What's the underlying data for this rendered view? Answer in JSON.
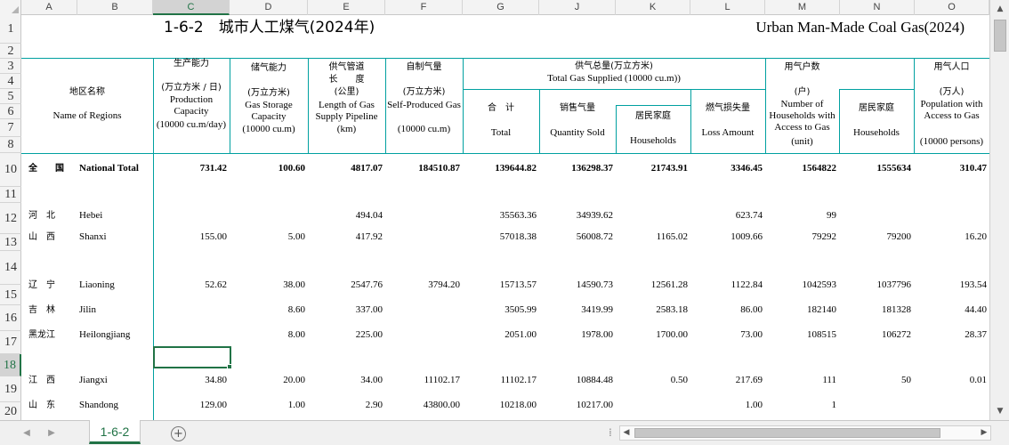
{
  "columns": {
    "A": "A",
    "B": "B",
    "C": "C",
    "D": "D",
    "E": "E",
    "F": "F",
    "G": "G",
    "J": "J",
    "K": "K",
    "L": "L",
    "M": "M",
    "N": "N",
    "O": "O"
  },
  "rows": [
    "1",
    "2",
    "3",
    "4",
    "5",
    "6",
    "7",
    "8",
    "10",
    "11",
    "12",
    "13",
    "14",
    "15",
    "16",
    "17",
    "18",
    "19",
    "20"
  ],
  "title": {
    "cn": "1-6-2　城市人工煤气(2024年)",
    "en": "Urban Man-Made Coal Gas(2024)"
  },
  "headers": {
    "region_cn": "地区名称",
    "region_en": "Name of Regions",
    "prod_cn": "生产能力",
    "prod_unit": "(万立方米 / 日)",
    "prod_en": "Production Capacity",
    "prod_en2": "(10000 cu.m/day)",
    "storage_cn": "储气能力",
    "storage_unit": "(万立方米)",
    "storage_en": "Gas Storage Capacity",
    "storage_en2": "(10000 cu.m)",
    "pipe_cn": "供气管道",
    "pipe_cn2": "长　　度",
    "pipe_unit": "(公里)",
    "pipe_en": "Length of Gas Supply Pipeline",
    "pipe_en2": "(km)",
    "self_cn": "自制气量",
    "self_unit": "(万立方米)",
    "self_en": "Self-Produced Gas",
    "self_en2": "(10000 cu.m)",
    "supply_cn": "供气总量(万立方米)",
    "supply_en": "Total Gas Supplied (10000 cu.m))",
    "total_cn": "合　计",
    "total_en": "Total",
    "sold_cn": "销售气量",
    "sold_en": "Quantity Sold",
    "hh_cn": "居民家庭",
    "hh_en": "Households",
    "loss_cn": "燃气损失量",
    "loss_en": "Loss Amount",
    "users_cn": "用气户数",
    "users_unit": "(户)",
    "users_en": "Number of Households with Access to Gas",
    "users_en2": "(unit)",
    "users_hh_cn": "居民家庭",
    "users_hh_en": "Households",
    "pop_cn": "用气人口",
    "pop_unit": "(万人)",
    "pop_en": "Population with Access to Gas",
    "pop_en2": "(10000 persons)"
  },
  "data_rows": [
    {
      "cn": "全　　国",
      "en": "National Total",
      "bold": true,
      "prod": "731.42",
      "storage": "100.60",
      "pipe": "4817.07",
      "self": "184510.87",
      "total": "139644.82",
      "sold": "136298.37",
      "hh": "21743.91",
      "loss": "3346.45",
      "users": "1564822",
      "users_hh": "1555634",
      "pop": "310.47"
    },
    {
      "cn": "",
      "en": "",
      "bold": false,
      "prod": "",
      "storage": "",
      "pipe": "",
      "self": "",
      "total": "",
      "sold": "",
      "hh": "",
      "loss": "",
      "users": "",
      "users_hh": "",
      "pop": ""
    },
    {
      "cn": "河　北",
      "en": "Hebei",
      "bold": false,
      "prod": "",
      "storage": "",
      "pipe": "494.04",
      "self": "",
      "total": "35563.36",
      "sold": "34939.62",
      "hh": "",
      "loss": "623.74",
      "users": "99",
      "users_hh": "",
      "pop": ""
    },
    {
      "cn": "山　西",
      "en": "Shanxi",
      "bold": false,
      "prod": "155.00",
      "storage": "5.00",
      "pipe": "417.92",
      "self": "",
      "total": "57018.38",
      "sold": "56008.72",
      "hh": "1165.02",
      "loss": "1009.66",
      "users": "79292",
      "users_hh": "79200",
      "pop": "16.20"
    },
    {
      "cn": "",
      "en": "",
      "bold": false,
      "prod": "",
      "storage": "",
      "pipe": "",
      "self": "",
      "total": "",
      "sold": "",
      "hh": "",
      "loss": "",
      "users": "",
      "users_hh": "",
      "pop": ""
    },
    {
      "cn": "辽　宁",
      "en": "Liaoning",
      "bold": false,
      "prod": "52.62",
      "storage": "38.00",
      "pipe": "2547.76",
      "self": "3794.20",
      "total": "15713.57",
      "sold": "14590.73",
      "hh": "12561.28",
      "loss": "1122.84",
      "users": "1042593",
      "users_hh": "1037796",
      "pop": "193.54"
    },
    {
      "cn": "吉　林",
      "en": "Jilin",
      "bold": false,
      "prod": "",
      "storage": "8.60",
      "pipe": "337.00",
      "self": "",
      "total": "3505.99",
      "sold": "3419.99",
      "hh": "2583.18",
      "loss": "86.00",
      "users": "182140",
      "users_hh": "181328",
      "pop": "44.40"
    },
    {
      "cn": "黑龙江",
      "en": "Heilongjiang",
      "bold": false,
      "prod": "",
      "storage": "8.00",
      "pipe": "225.00",
      "self": "",
      "total": "2051.00",
      "sold": "1978.00",
      "hh": "1700.00",
      "loss": "73.00",
      "users": "108515",
      "users_hh": "106272",
      "pop": "28.37"
    },
    {
      "cn": "",
      "en": "",
      "bold": false,
      "prod": "",
      "storage": "",
      "pipe": "",
      "self": "",
      "total": "",
      "sold": "",
      "hh": "",
      "loss": "",
      "users": "",
      "users_hh": "",
      "pop": ""
    },
    {
      "cn": "江　西",
      "en": "Jiangxi",
      "bold": false,
      "prod": "34.80",
      "storage": "20.00",
      "pipe": "34.00",
      "self": "11102.17",
      "total": "11102.17",
      "sold": "10884.48",
      "hh": "0.50",
      "loss": "217.69",
      "users": "111",
      "users_hh": "50",
      "pop": "0.01"
    },
    {
      "cn": "山　东",
      "en": "Shandong",
      "bold": false,
      "prod": "129.00",
      "storage": "1.00",
      "pipe": "2.90",
      "self": "43800.00",
      "total": "10218.00",
      "sold": "10217.00",
      "hh": "",
      "loss": "1.00",
      "users": "1",
      "users_hh": "",
      "pop": ""
    }
  ],
  "sheet": {
    "tab_label": "1-6-2",
    "add_label": "+",
    "hsep": "⁞"
  },
  "icons": {
    "up": "▲",
    "down": "▼",
    "left": "◀",
    "right": "▶",
    "first": "◀",
    "last": "▶"
  },
  "colors": {
    "accent": "#217346",
    "grid": "#00a0a0"
  }
}
